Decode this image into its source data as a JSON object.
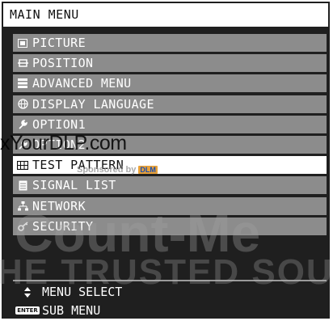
{
  "title": "MAIN MENU",
  "menu": {
    "items": [
      {
        "label": "PICTURE",
        "icon": "picture-icon",
        "selected": false
      },
      {
        "label": "POSITION",
        "icon": "position-icon",
        "selected": false
      },
      {
        "label": "ADVANCED MENU",
        "icon": "advanced-menu-icon",
        "selected": false
      },
      {
        "label": "DISPLAY LANGUAGE",
        "icon": "globe-icon",
        "selected": false
      },
      {
        "label": "OPTION1",
        "icon": "wrench-icon",
        "selected": false
      },
      {
        "label": "OPTION2",
        "icon": "wrench-icon",
        "selected": false
      },
      {
        "label": "TEST PATTERN",
        "icon": "test-pattern-icon",
        "selected": true
      },
      {
        "label": "SIGNAL LIST",
        "icon": "signal-list-icon",
        "selected": false
      },
      {
        "label": "NETWORK",
        "icon": "network-icon",
        "selected": false
      },
      {
        "label": "SECURITY",
        "icon": "key-icon",
        "selected": false
      }
    ]
  },
  "hints": {
    "select_label": "MENU SELECT",
    "enter_key": "ENTER",
    "sub_label": "SUB MENU"
  },
  "watermark": {
    "site": "xYourDLP.com",
    "sponsored": "Sponsored by",
    "badge": "DLM",
    "brand": "Count-Me",
    "tagline": "HE TRUSTED SOURC"
  },
  "colors": {
    "background": "#1f1f1f",
    "item_bg": "#8c8c8c",
    "item_selected_bg": "#ffffff",
    "title_bg": "#ffffff"
  }
}
